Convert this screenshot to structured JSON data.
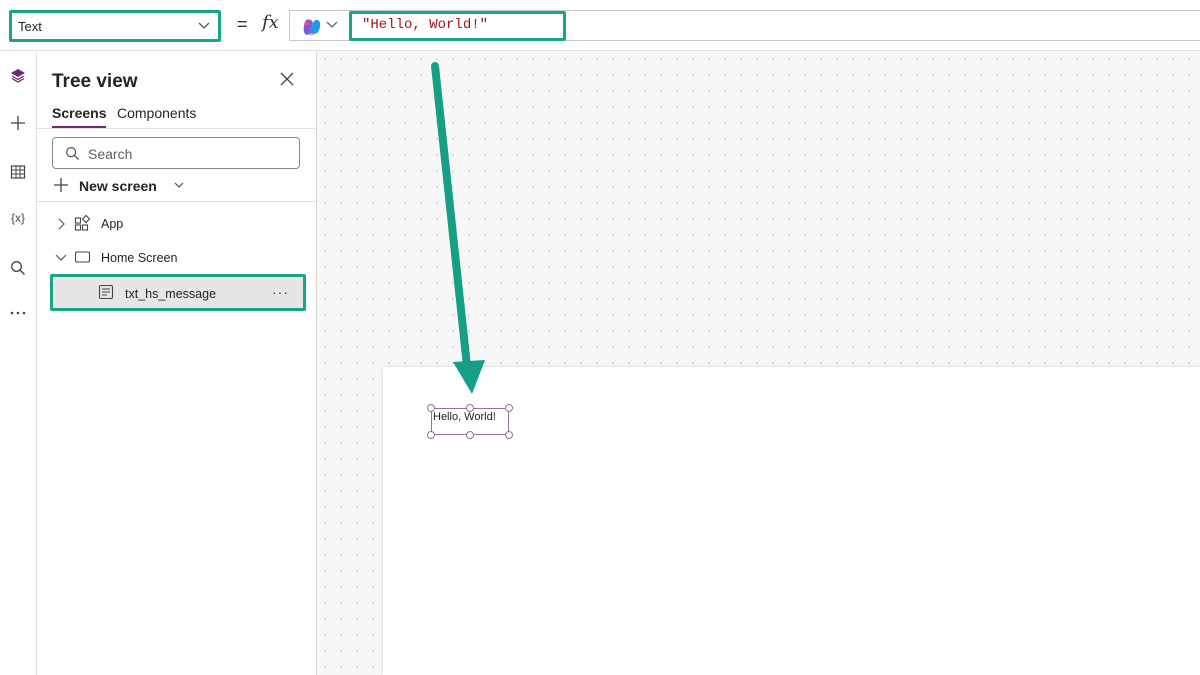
{
  "formula_bar": {
    "property": "Text",
    "equals": "=",
    "fx": "fx",
    "formula": "\"Hello, World!\""
  },
  "rail": {
    "icons": [
      "layers-icon",
      "plus-icon",
      "table-icon",
      "variables-icon",
      "search-icon",
      "more-icon"
    ],
    "variables_glyph": "{x}"
  },
  "tree_view": {
    "title": "Tree view",
    "tabs": [
      "Screens",
      "Components"
    ],
    "search_placeholder": "Search",
    "new_screen": "New screen",
    "nodes": {
      "app": "App",
      "home_screen": "Home Screen",
      "control": "txt_hs_message"
    },
    "more": "···"
  },
  "canvas": {
    "label_text": "Hello, World!"
  },
  "colors": {
    "highlight": "#18a58a",
    "arrow": "#15a086",
    "accent": "#742774",
    "formula_string": "#a31515"
  }
}
